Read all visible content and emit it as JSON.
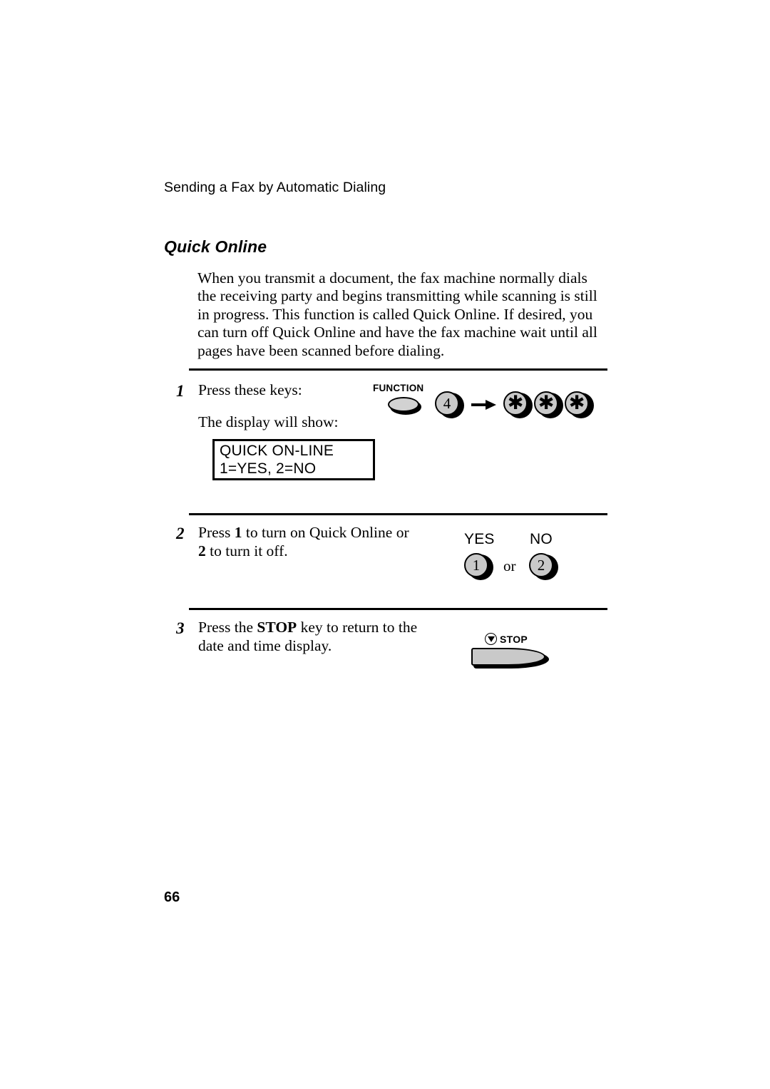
{
  "document": {
    "running_header": "Sending a Fax by Automatic Dialing",
    "section_heading": "Quick Online",
    "page_number": "66",
    "intro_paragraph": "When you transmit a document, the fax machine normally dials the receiving party and begins transmitting while scanning is still in progress. This function is called Quick Online. If desired, you can turn off Quick Online and have the fax machine wait until all pages have been scanned before dialing."
  },
  "steps": [
    {
      "number": "1",
      "line1": "Press these keys:",
      "line2": "The display will show:"
    },
    {
      "number": "2",
      "text_pre": "Press ",
      "bold_1": "1",
      "text_mid": " to turn on Quick Online or ",
      "bold_2": "2",
      "text_post": " to turn it off."
    },
    {
      "number": "3",
      "text_pre": "Press the ",
      "bold_1": "STOP",
      "text_post": " key to return to the date and time display."
    }
  ],
  "keys_step1": {
    "function_label": "FUNCTION",
    "key_4": "4",
    "star_1": "✱",
    "star_2": "✱",
    "star_3": "✱"
  },
  "lcd_display": {
    "line_1": "QUICK ON-LINE",
    "line_2": "1=YES, 2=NO"
  },
  "keys_step2": {
    "yes_label": "YES",
    "no_label": "NO",
    "key_1": "1",
    "or_word": "or",
    "key_2": "2"
  },
  "keys_step3": {
    "stop_label": "STOP"
  },
  "colors": {
    "key_face": "#c9c9c9",
    "key_shadow": "#000000",
    "text": "#000000",
    "page_background": "#ffffff"
  }
}
